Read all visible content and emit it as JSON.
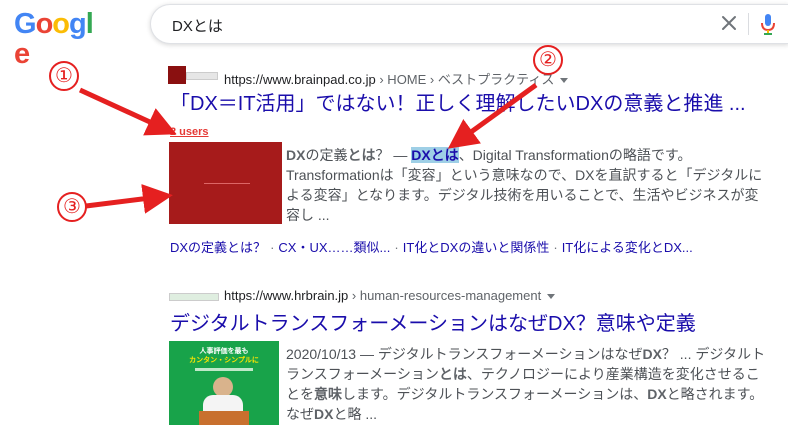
{
  "header": {
    "logo_letters": [
      {
        "ch": "G",
        "color": "#4285F4"
      },
      {
        "ch": "o",
        "color": "#EA4335"
      },
      {
        "ch": "o",
        "color": "#FBBC05"
      },
      {
        "ch": "g",
        "color": "#4285F4"
      },
      {
        "ch": "l",
        "color": "#34A853"
      },
      {
        "ch": "e",
        "color": "#EA4335"
      }
    ],
    "query": "DXとは",
    "clear_icon": "close-icon",
    "mic_icon": "microphone-icon"
  },
  "results": [
    {
      "url": "https://www.brainpad.co.jp",
      "path": " › HOME › ベストプラクティス",
      "title": "「DX＝IT活用」ではない！正しく理解したいDXの意義と推進 ...",
      "users": "2 users",
      "snippet_lines": [
        [
          "DX",
          "の定義",
          "とは",
          "？ — ",
          "DXとは",
          "、Digital Transformationの略語です。"
        ],
        "Transformationは「変容」という意味なので、DXを直訳すると「デジタルに",
        "よる変容」となります。デジタル技術を用いることで、生活やビジネスが変",
        "容し ..."
      ],
      "sitelinks": [
        "DXの定義とは？",
        "CX・UX……類似...",
        "IT化とDXの違いと関係性",
        "IT化による変化とDX..."
      ]
    },
    {
      "url": "https://www.hrbrain.jp",
      "path": " › human-resources-management",
      "title": "デジタルトランスフォーメーションはなぜDX？意味や定義",
      "thumb_text": [
        "人事評価を最も",
        "カンタン・シンプルに"
      ],
      "snippet_lines": [
        [
          "2020/10/13 — デジタルトランスフォーメーションはなぜ",
          "DX",
          "？ ... デジタルト"
        ],
        [
          "ランスフォーメーション",
          "とは",
          "、テクノロジーにより産業構造を変化させるこ"
        ],
        [
          "とを",
          "意味",
          "します。デジタルトランスフォーメーションは、",
          "DX",
          "と略されます。"
        ],
        [
          "なぜ",
          "DX",
          "と略 ..."
        ]
      ]
    }
  ],
  "annotations": {
    "labels": [
      "①",
      "②",
      "③"
    ],
    "color": "#E52020"
  }
}
